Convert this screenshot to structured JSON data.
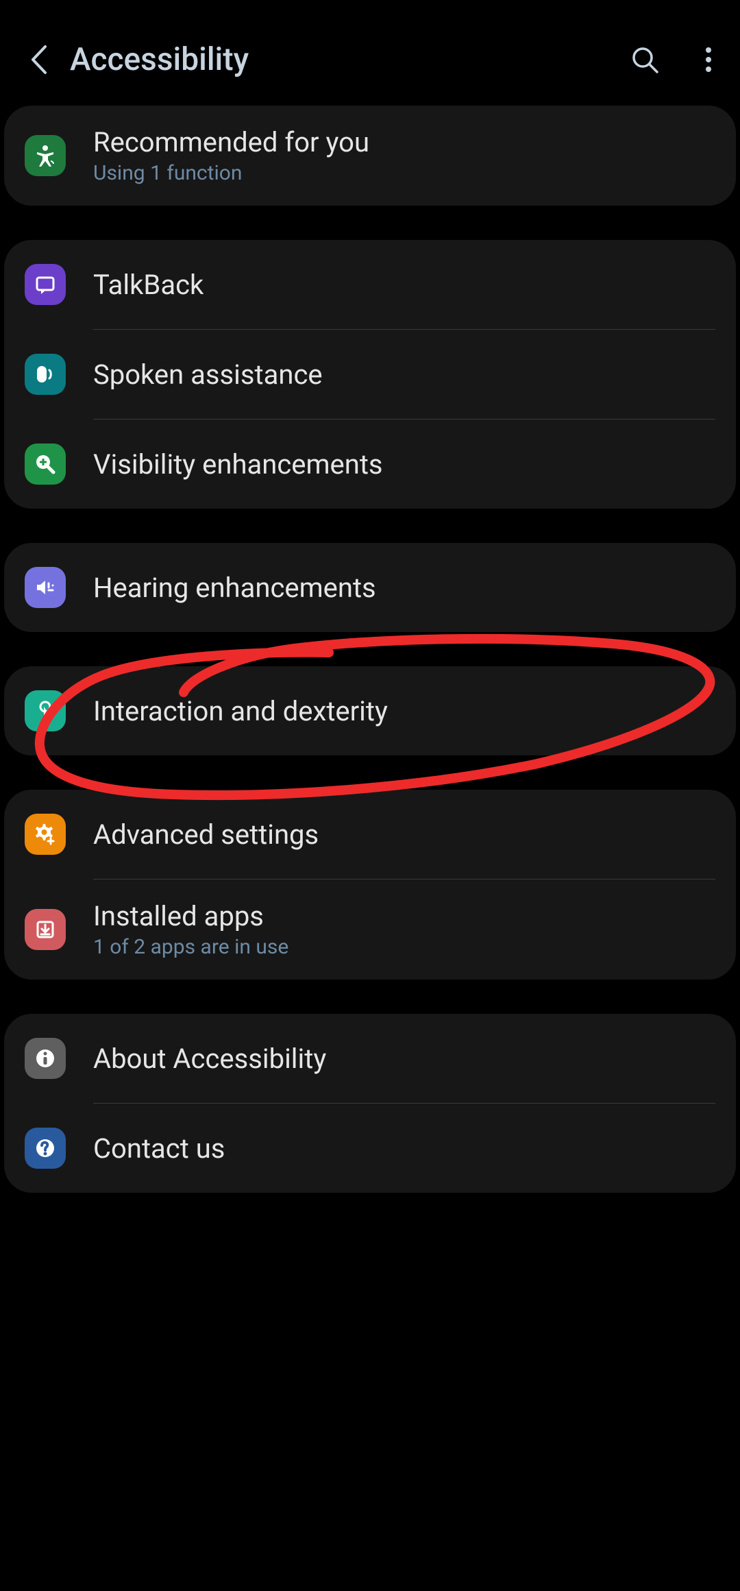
{
  "header": {
    "title": "Accessibility"
  },
  "groups": [
    {
      "items": [
        {
          "title": "Recommended for you",
          "subtitle": "Using 1 function",
          "icon": "accessibility",
          "iconClass": "icon-green"
        }
      ]
    },
    {
      "items": [
        {
          "title": "TalkBack",
          "icon": "chat",
          "iconClass": "icon-purple"
        },
        {
          "title": "Spoken assistance",
          "icon": "speaker",
          "iconClass": "icon-teal"
        },
        {
          "title": "Visibility enhancements",
          "icon": "magnify",
          "iconClass": "icon-green2"
        }
      ]
    },
    {
      "items": [
        {
          "title": "Hearing enhancements",
          "icon": "sound",
          "iconClass": "icon-purple2"
        }
      ]
    },
    {
      "items": [
        {
          "title": "Interaction and dexterity",
          "icon": "touch",
          "iconClass": "icon-teal2"
        }
      ]
    },
    {
      "items": [
        {
          "title": "Advanced settings",
          "icon": "gear",
          "iconClass": "icon-orange"
        },
        {
          "title": "Installed apps",
          "subtitle": "1 of 2 apps are in use",
          "icon": "download",
          "iconClass": "icon-red"
        }
      ]
    },
    {
      "items": [
        {
          "title": "About Accessibility",
          "icon": "info",
          "iconClass": "icon-gray"
        },
        {
          "title": "Contact us",
          "icon": "help",
          "iconClass": "icon-blue"
        }
      ]
    }
  ]
}
